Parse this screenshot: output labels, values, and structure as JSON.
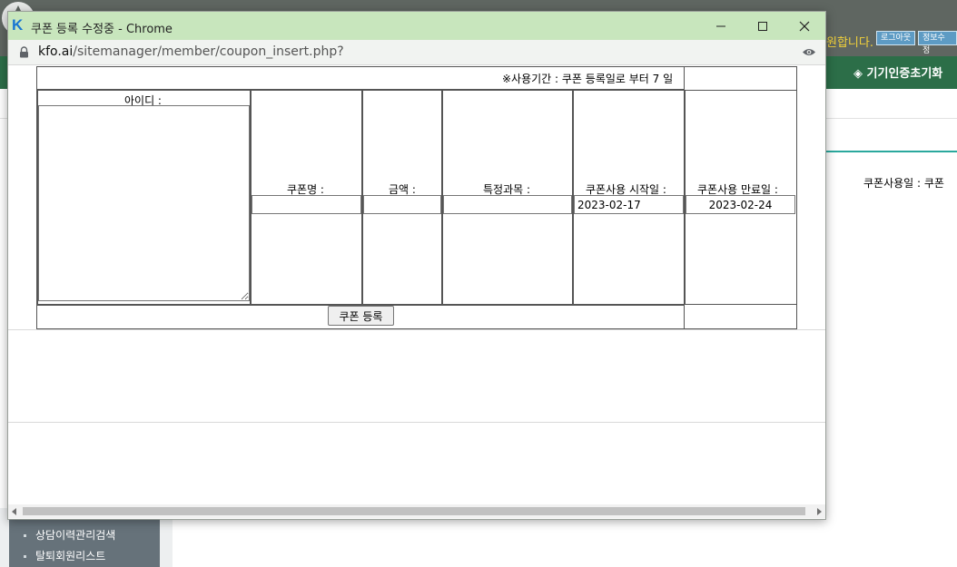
{
  "background": {
    "greeting": "원합니다.",
    "logout_label": "로그아웃",
    "edit_info_label": "정보수정",
    "nav_item": "◈ 기기인증초기화",
    "usage_text": "쿠폰사용일 : 쿠폰",
    "sidebar_items": [
      "상담이력관리검색",
      "탈퇴회원리스트"
    ]
  },
  "window": {
    "title": "쿠폰 등록 수정중 - Chrome",
    "url_domain": "kfo.ai",
    "url_path": "/sitemanager/member/coupon_insert.php?"
  },
  "form": {
    "notice": "※사용기간 : 쿠폰 등록일로 부터 7 일",
    "id_label": "아이디 :",
    "id_value": "",
    "name_label": "쿠폰명 :",
    "name_value": "",
    "amount_label": "금액 :",
    "amount_value": "",
    "subject_label": "특정과목 :",
    "subject_value": "",
    "start_label": "쿠폰사용 시작일 :",
    "start_value": "2023-02-17",
    "end_label": "쿠폰사용 만료일 :",
    "end_value": "2023-02-24",
    "submit_label": "쿠폰 등록"
  },
  "colors": {
    "titlebar": "#c8e6bd",
    "nav": "#2c6e48",
    "accent_line": "#2aa89d"
  }
}
